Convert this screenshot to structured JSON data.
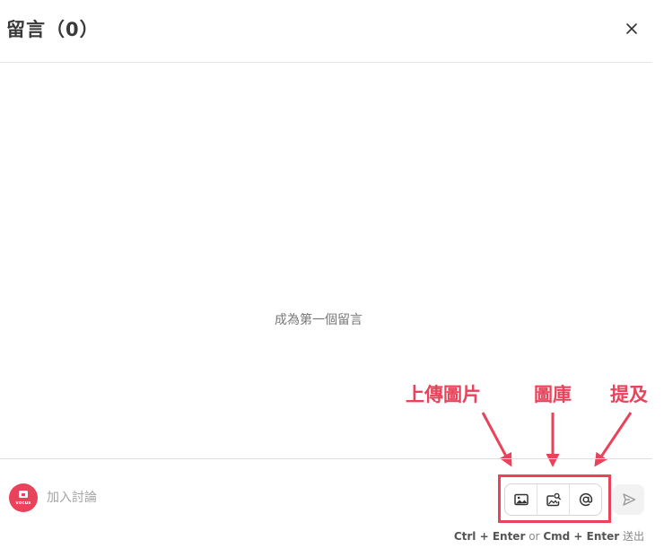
{
  "header": {
    "title": "留言（0）"
  },
  "empty_state": {
    "message": "成為第一個留言"
  },
  "annotations": {
    "upload": "上傳圖片",
    "gallery": "圖庫",
    "mention": "提及"
  },
  "composer": {
    "placeholder": "加入討論",
    "avatar_text": "vocus"
  },
  "shortcut_hint": {
    "key1": "Ctrl + Enter",
    "or": "or",
    "key2": "Cmd + Enter",
    "action": "送出"
  },
  "colors": {
    "annotation": "#e8435a",
    "avatar_bg": "#e8435a"
  },
  "icons": {
    "close": "close-icon",
    "upload": "image-icon",
    "gallery": "image-search-icon",
    "mention": "at-sign-icon",
    "send": "send-icon"
  }
}
